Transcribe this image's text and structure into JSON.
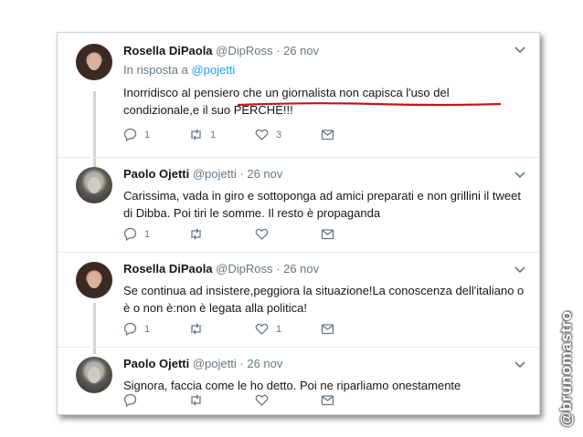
{
  "tweets": [
    {
      "name": "Rosella DiPaola",
      "handle": "@DipRoss",
      "dot": "·",
      "time": "26 nov",
      "reply_prefix": "In risposta a ",
      "reply_mention": "@pojetti",
      "text": "Inorridisco al pensiero che un giornalista non capisca l'uso del condizionale,e il suo PERCHÉ!!!",
      "reply_count": "1",
      "retweet_count": "1",
      "like_count": "3"
    },
    {
      "name": "Paolo Ojetti",
      "handle": "@pojetti",
      "dot": "·",
      "time": "26 nov",
      "text": "Carissima, vada in giro e sottoponga ad amici preparati e non grillini il tweet di Dibba. Poi tiri le somme. Il resto è propaganda",
      "reply_count": "1",
      "retweet_count": "",
      "like_count": ""
    },
    {
      "name": "Rosella DiPaola",
      "handle": "@DipRoss",
      "dot": "·",
      "time": "26 nov",
      "text": "Se continua ad insistere,peggiora la situazione!La conoscenza dell'italiano o è o non è:non è legata alla politica!",
      "reply_count": "1",
      "retweet_count": "",
      "like_count": "1"
    },
    {
      "name": "Paolo Ojetti",
      "handle": "@pojetti",
      "dot": "·",
      "time": "26 nov",
      "text": "Signora, faccia come le ho detto. Poi ne riparliamo onestamente",
      "reply_count": "",
      "retweet_count": "",
      "like_count": ""
    }
  ],
  "watermark": "@brunomastro",
  "colors": {
    "text": "#14171a",
    "muted": "#657786",
    "link": "#1da1f2",
    "underline": "#c0161a"
  }
}
